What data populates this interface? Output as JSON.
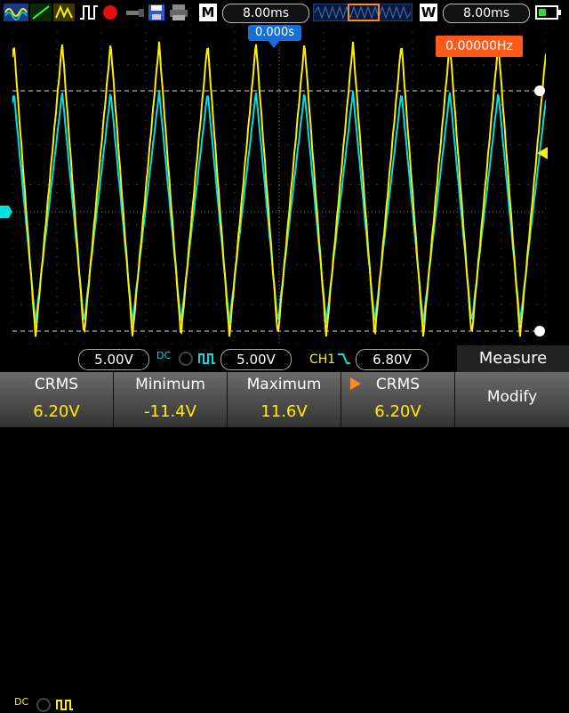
{
  "toolbar": {
    "mode_letter": "M",
    "time_main": "8.00ms",
    "window_letter": "W",
    "time_window": "8.00ms"
  },
  "screen": {
    "trigger_time": "0.000s",
    "frequency": "0.00000Hz",
    "ch1_color": "#ffee00",
    "ch2_color": "#00e0e0"
  },
  "status": {
    "ch1_coupling": "DC",
    "ch1_scale": "5.00V",
    "ch2_coupling": "DC",
    "ch2_scale": "5.00V",
    "trigger_source": "CH1",
    "trigger_level": "6.80V",
    "menu_title": "Measure"
  },
  "softkeys": [
    {
      "label": "CRMS",
      "value": "6.20V"
    },
    {
      "label": "Minimum",
      "value": "-11.4V"
    },
    {
      "label": "Maximum",
      "value": "11.6V"
    },
    {
      "label": "CRMS",
      "value": "6.20V"
    },
    {
      "label": "Modify",
      "value": ""
    }
  ]
}
